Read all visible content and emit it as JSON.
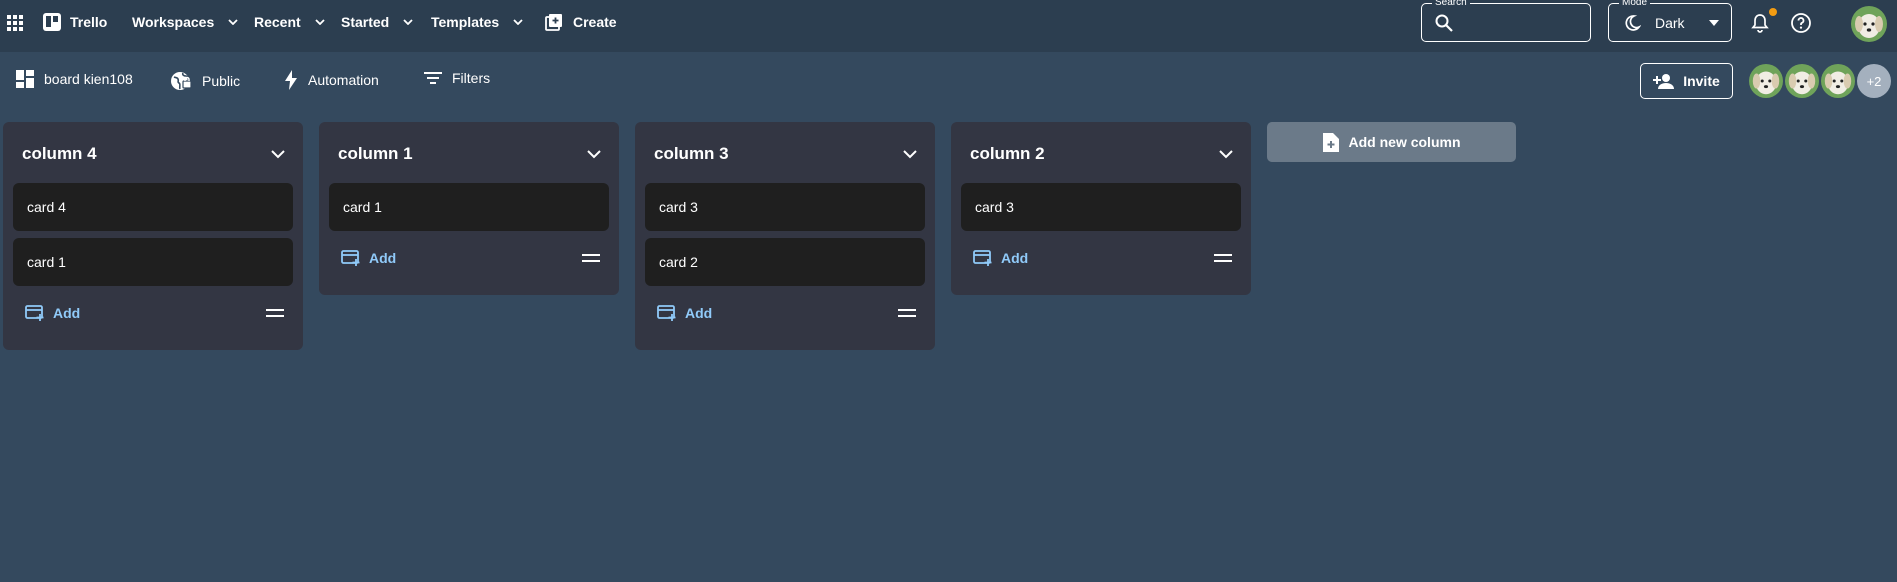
{
  "appbar": {
    "brand": "Trello",
    "menus": [
      {
        "label": "Workspaces"
      },
      {
        "label": "Recent"
      },
      {
        "label": "Started"
      },
      {
        "label": "Templates"
      }
    ],
    "create_label": "Create",
    "search": {
      "legend": "Search",
      "value": ""
    },
    "mode": {
      "legend": "Mode",
      "value": "Dark"
    },
    "accent_dot_color": "#f39c12"
  },
  "boardbar": {
    "board_name": "board kien108",
    "visibility": "Public",
    "automation": "Automation",
    "filters": "Filters",
    "invite_label": "Invite",
    "more_members": "+2"
  },
  "columns": [
    {
      "title": "column 4",
      "cards": [
        "card 4",
        "card 1"
      ],
      "add_label": "Add"
    },
    {
      "title": "column 1",
      "cards": [
        "card 1"
      ],
      "add_label": "Add"
    },
    {
      "title": "column 3",
      "cards": [
        "card 3",
        "card 2"
      ],
      "add_label": "Add"
    },
    {
      "title": "column 2",
      "cards": [
        "card 3"
      ],
      "add_label": "Add"
    }
  ],
  "add_column_label": "Add new column",
  "colors": {
    "page_bg": "#34495e",
    "appbar_bg": "#2c3e50",
    "column_bg": "#333643",
    "card_bg": "#1f1f1f",
    "add_link": "#90caf9"
  }
}
